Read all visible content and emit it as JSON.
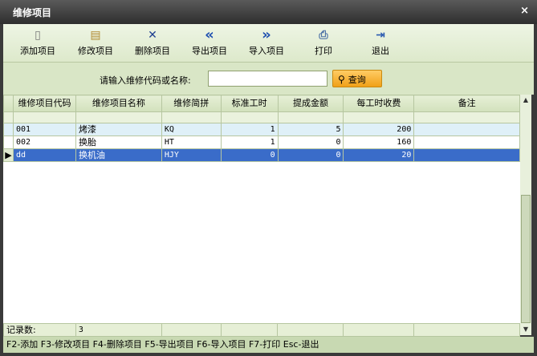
{
  "window": {
    "title": "维修项目",
    "close_glyph": "×"
  },
  "toolbar": {
    "buttons": [
      {
        "label": "添加项目",
        "icon": "new-document-icon",
        "glyph": "▯"
      },
      {
        "label": "修改项目",
        "icon": "clipboard-icon",
        "glyph": "▤"
      },
      {
        "label": "删除项目",
        "icon": "delete-x-icon",
        "glyph": "✕"
      },
      {
        "label": "导出项目",
        "icon": "double-left-arrow-icon",
        "glyph": "«"
      },
      {
        "label": "导入项目",
        "icon": "double-right-arrow-icon",
        "glyph": "»"
      },
      {
        "label": "打印",
        "icon": "printer-icon",
        "glyph": "⎙"
      },
      {
        "label": "退出",
        "icon": "exit-door-icon",
        "glyph": "⇥"
      }
    ]
  },
  "search": {
    "label": "请输入维修代码或名称:",
    "value": "",
    "button_label": "查询",
    "button_icon": "magnifier-icon"
  },
  "table": {
    "columns": [
      "维修项目代码",
      "维修项目名称",
      "维修简拼",
      "标准工时",
      "提成金额",
      "每工时收费",
      "备注"
    ],
    "rows": [
      {
        "code": "001",
        "name": "烤漆",
        "pinyin": "KQ",
        "hours": "1",
        "commission": "5",
        "fee": "200",
        "note": ""
      },
      {
        "code": "002",
        "name": "换胎",
        "pinyin": "HT",
        "hours": "1",
        "commission": "0",
        "fee": "160",
        "note": ""
      },
      {
        "code": "dd",
        "name": "换机油",
        "pinyin": "HJY",
        "hours": "0",
        "commission": "0",
        "fee": "20",
        "note": ""
      }
    ],
    "selected_row": 2,
    "row_indicator": "▶",
    "footer": {
      "label": "记录数:",
      "count": "3"
    }
  },
  "statusbar": {
    "text": "F2-添加 F3-修改项目 F4-删除项目 F5-导出项目 F6-导入项目 F7-打印 Esc-退出"
  },
  "colors": {
    "selected_row": "#3a6cc9",
    "alt_row": "#dff0f8",
    "accent": "#f0a018"
  }
}
